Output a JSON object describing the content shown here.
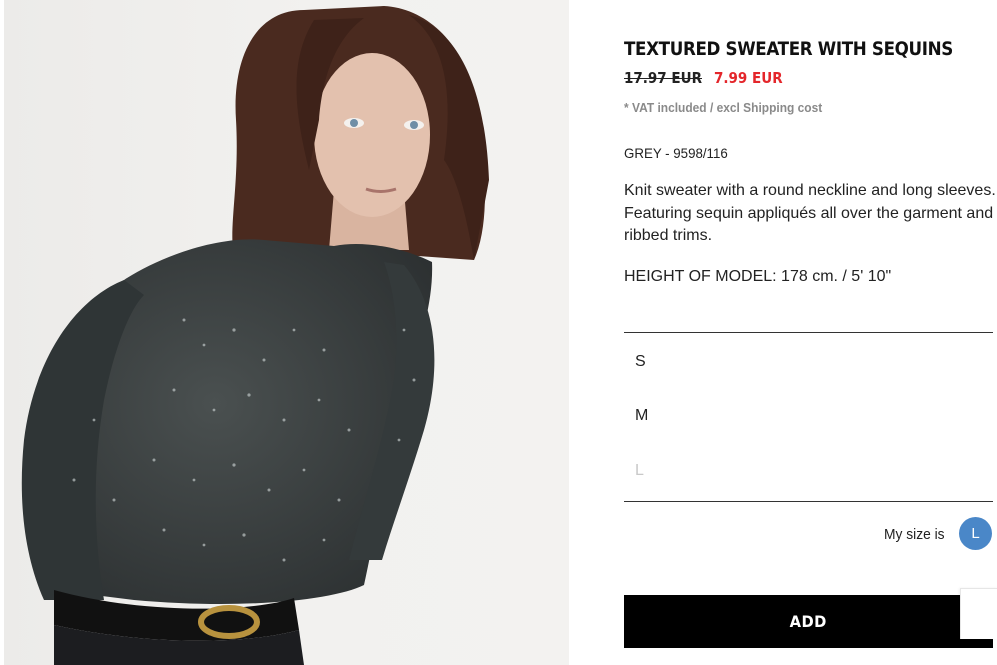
{
  "product": {
    "title": "TEXTURED SWEATER WITH SEQUINS",
    "old_price": "17.97 EUR",
    "new_price": "7.99 EUR",
    "vat_note": "* VAT included / excl Shipping cost",
    "color_ref": "GREY - 9598/116",
    "description": "Knit sweater with a round neckline and long sleeves. Featuring sequin appliqués all over the garment and ribbed trims.",
    "model_height": "HEIGHT OF MODEL: 178 cm. / 5' 10\""
  },
  "sizes": [
    {
      "label": "S",
      "available": true
    },
    {
      "label": "M",
      "available": true
    },
    {
      "label": "L",
      "available": false
    }
  ],
  "my_size": {
    "label": "My size is",
    "value": "L"
  },
  "actions": {
    "add_label": "ADD"
  },
  "colors": {
    "sale_price": "#e4262b",
    "accent": "#4a87c8",
    "button": "#000000"
  }
}
